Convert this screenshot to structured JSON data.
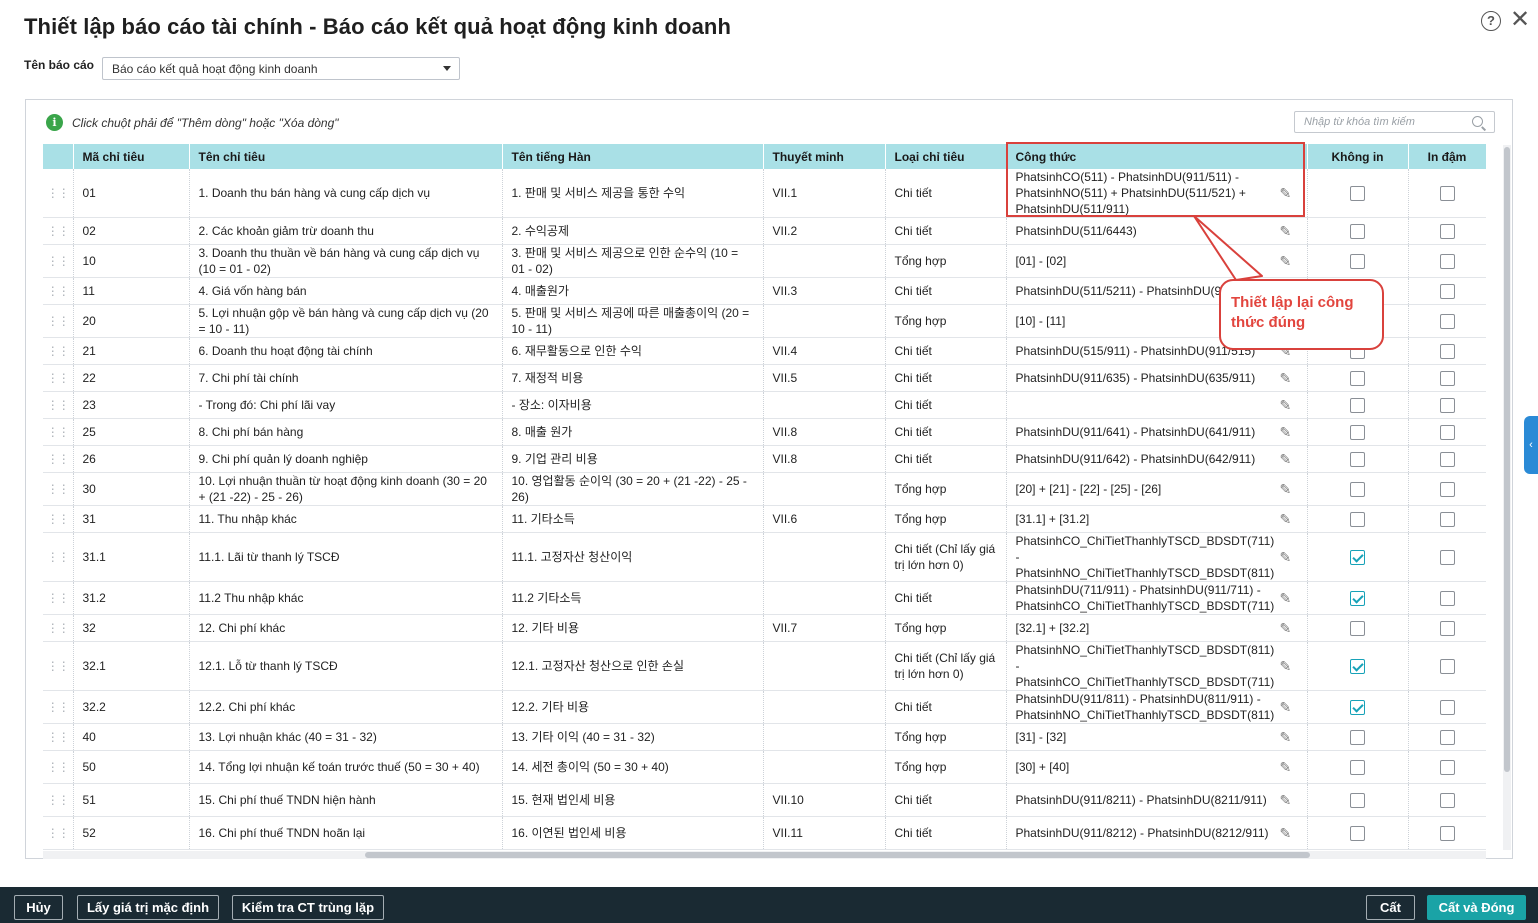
{
  "dialog": {
    "title": "Thiết lập báo cáo tài chính - Báo cáo kết quả hoạt động kinh doanh",
    "help_icon": "?",
    "close_icon": "✕"
  },
  "report": {
    "label": "Tên báo cáo",
    "selected": "Báo cáo kết quả hoạt động kinh doanh"
  },
  "toolbar": {
    "hint": "Click chuột phải để \"Thêm dòng\" hoặc \"Xóa dòng\"",
    "search_placeholder": "Nhập từ khóa tìm kiếm"
  },
  "columns": {
    "code": "Mã chỉ tiêu",
    "name": "Tên chỉ tiêu",
    "korean": "Tên tiếng Hàn",
    "note": "Thuyết minh",
    "type": "Loại chỉ tiêu",
    "formula": "Công thức",
    "no_print": "Không in",
    "bold": "In đậm"
  },
  "rows": [
    {
      "code": "01",
      "name": "1. Doanh thu bán hàng và cung cấp dịch vụ",
      "korean": "1. 판매 및 서비스 제공을 통한 수익",
      "note": "VII.1",
      "type": "Chi tiết",
      "formula": "PhatsinhCO(511) - PhatsinhDU(911/511) - PhatsinhNO(511) + PhatsinhDU(511/521) + PhatsinhDU(511/911)",
      "no_print": false,
      "bold": false
    },
    {
      "code": "02",
      "name": "2. Các khoản giảm trừ doanh thu",
      "korean": "2. 수익공제",
      "note": "VII.2",
      "type": "Chi tiết",
      "formula": "PhatsinhDU(511/6443)",
      "no_print": false,
      "bold": false
    },
    {
      "code": "10",
      "name": "3. Doanh thu thuần về bán hàng và cung cấp dịch vụ (10 = 01 - 02)",
      "korean": "3. 판매 및 서비스 제공으로 인한 순수익 (10 = 01 - 02)",
      "note": "",
      "type": "Tổng hợp",
      "formula": "[01] - [02]",
      "no_print": false,
      "bold": false
    },
    {
      "code": "11",
      "name": "4. Giá vốn hàng bán",
      "korean": "4. 매출원가",
      "note": "VII.3",
      "type": "Chi tiết",
      "formula": "PhatsinhDU(511/5211) - PhatsinhDU(911/632)",
      "no_print": false,
      "bold": false
    },
    {
      "code": "20",
      "name": "5. Lợi nhuận gộp về bán hàng và cung cấp dịch vụ (20 = 10 - 11)",
      "korean": "5. 판매 및 서비스 제공에 따른 매출총이익 (20 = 10 - 11)",
      "note": "",
      "type": "Tổng hợp",
      "formula": "[10] - [11]",
      "no_print": false,
      "bold": false
    },
    {
      "code": "21",
      "name": "6. Doanh thu hoạt động tài chính",
      "korean": "6. 재무활동으로 인한 수익",
      "note": "VII.4",
      "type": "Chi tiết",
      "formula": "PhatsinhDU(515/911) - PhatsinhDU(911/515)",
      "no_print": false,
      "bold": false
    },
    {
      "code": "22",
      "name": "7. Chi phí tài chính",
      "korean": "7. 재정적 비용",
      "note": "VII.5",
      "type": "Chi tiết",
      "formula": "PhatsinhDU(911/635) - PhatsinhDU(635/911)",
      "no_print": false,
      "bold": false
    },
    {
      "code": "23",
      "name": "- Trong đó: Chi phí lãi vay",
      "korean": "- 장소: 이자비용",
      "note": "",
      "type": "Chi tiết",
      "formula": "",
      "no_print": false,
      "bold": false
    },
    {
      "code": "25",
      "name": "8. Chi phí bán hàng",
      "korean": "8. 매출 원가",
      "note": "VII.8",
      "type": "Chi tiết",
      "formula": "PhatsinhDU(911/641) - PhatsinhDU(641/911)",
      "no_print": false,
      "bold": false
    },
    {
      "code": "26",
      "name": "9. Chi phí quản lý doanh nghiệp",
      "korean": "9. 기업 관리 비용",
      "note": "VII.8",
      "type": "Chi tiết",
      "formula": "PhatsinhDU(911/642) - PhatsinhDU(642/911)",
      "no_print": false,
      "bold": false
    },
    {
      "code": "30",
      "name": "10. Lợi nhuận thuần từ hoạt động kinh doanh (30 = 20 + (21 -22) - 25 - 26)",
      "korean": "10. 영업활동 순이익 (30 = 20 + (21 -22) - 25 - 26)",
      "note": "",
      "type": "Tổng hợp",
      "formula": "[20] + [21] - [22] - [25] - [26]",
      "no_print": false,
      "bold": false
    },
    {
      "code": "31",
      "name": "11. Thu nhập khác",
      "korean": "11. 기타소득",
      "note": "VII.6",
      "type": "Tổng hợp",
      "formula": "[31.1] + [31.2]",
      "no_print": false,
      "bold": false
    },
    {
      "code": "31.1",
      "name": "11.1. Lãi từ thanh lý TSCĐ",
      "korean": "11.1. 고정자산 청산이익",
      "note": "",
      "type": "Chi tiết (Chỉ lấy giá trị lớn hơn 0)",
      "formula": "PhatsinhCO_ChiTietThanhlyTSCD_BDSDT(711) - PhatsinhNO_ChiTietThanhlyTSCD_BDSDT(811)",
      "no_print": true,
      "bold": false
    },
    {
      "code": "31.2",
      "name": "11.2 Thu nhập khác",
      "korean": "11.2 기타소득",
      "note": "",
      "type": "Chi tiết",
      "formula": "PhatsinhDU(711/911) - PhatsinhDU(911/711) - PhatsinhCO_ChiTietThanhlyTSCD_BDSDT(711)",
      "no_print": true,
      "bold": false
    },
    {
      "code": "32",
      "name": "12. Chi phí khác",
      "korean": "12. 기타 비용",
      "note": "VII.7",
      "type": "Tổng hợp",
      "formula": "[32.1] + [32.2]",
      "no_print": false,
      "bold": false
    },
    {
      "code": "32.1",
      "name": "12.1. Lỗ từ thanh lý TSCĐ",
      "korean": "12.1. 고정자산 청산으로 인한 손실",
      "note": "",
      "type": "Chi tiết (Chỉ lấy giá trị lớn hơn 0)",
      "formula": "PhatsinhNO_ChiTietThanhlyTSCD_BDSDT(811) - PhatsinhCO_ChiTietThanhlyTSCD_BDSDT(711)",
      "no_print": true,
      "bold": false
    },
    {
      "code": "32.2",
      "name": "12.2. Chi phí khác",
      "korean": "12.2. 기타 비용",
      "note": "",
      "type": "Chi tiết",
      "formula": "PhatsinhDU(911/811) - PhatsinhDU(811/911) - PhatsinhNO_ChiTietThanhlyTSCD_BDSDT(811)",
      "no_print": true,
      "bold": false
    },
    {
      "code": "40",
      "name": "13. Lợi nhuận khác (40 = 31 - 32)",
      "korean": "13. 기타 이익 (40 = 31 - 32)",
      "note": "",
      "type": "Tổng hợp",
      "formula": "[31] - [32]",
      "no_print": false,
      "bold": false
    },
    {
      "code": "50",
      "name": "14. Tổng lợi nhuận kế toán trước thuế (50 = 30 + 40)",
      "korean": "14. 세전 총이익 (50 = 30 + 40)",
      "note": "",
      "type": "Tổng hợp",
      "formula": "[30] + [40]",
      "no_print": false,
      "bold": false
    },
    {
      "code": "51",
      "name": "15. Chi phí thuế TNDN hiện hành",
      "korean": "15. 현재 법인세 비용",
      "note": "VII.10",
      "type": "Chi tiết",
      "formula": "PhatsinhDU(911/8211) - PhatsinhDU(8211/911)",
      "no_print": false,
      "bold": false
    },
    {
      "code": "52",
      "name": "16. Chi phí thuế TNDN hoãn lại",
      "korean": "16. 이연된 법인세 비용",
      "note": "VII.11",
      "type": "Chi tiết",
      "formula": "PhatsinhDU(911/8212) - PhatsinhDU(8212/911)",
      "no_print": false,
      "bold": false
    }
  ],
  "annotation": {
    "text": "Thiết lập lại công thức đúng",
    "color": "#d9413c"
  },
  "footer": {
    "cancel": "Hủy",
    "defaults": "Lấy giá trị mặc định",
    "check_dup": "Kiểm tra CT trùng lặp",
    "save": "Cất",
    "save_close": "Cất và Đóng"
  },
  "colors": {
    "header_bg": "#a9e0e6",
    "primary": "#1aa3a6",
    "footer_bg": "#1a2a33",
    "check": "#17a2b8"
  }
}
